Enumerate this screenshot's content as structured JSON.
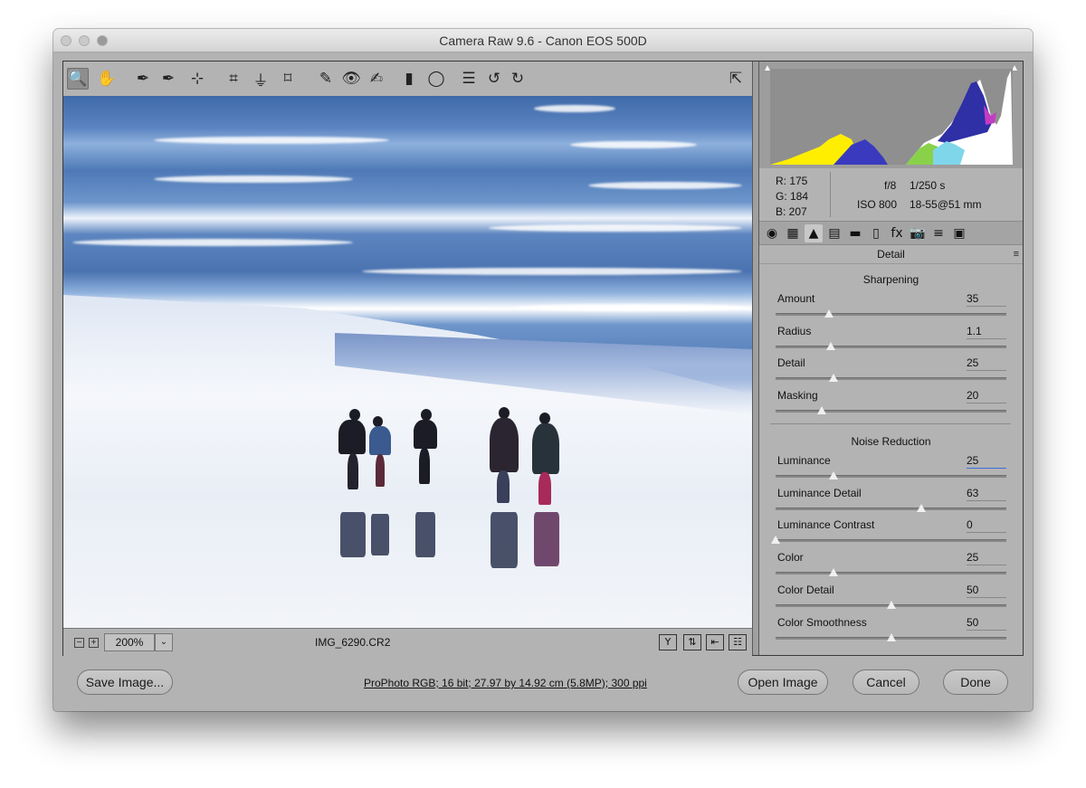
{
  "window": {
    "title": "Camera Raw 9.6  -  Canon EOS 500D"
  },
  "toolbar": {
    "tools": [
      {
        "name": "zoom-tool-icon",
        "glyph": "🔍"
      },
      {
        "name": "hand-tool-icon",
        "glyph": "✋"
      },
      {
        "name": "white-balance-tool-icon",
        "glyph": "✒"
      },
      {
        "name": "color-sampler-tool-icon",
        "glyph": "✒"
      },
      {
        "name": "targeted-adjustment-tool-icon",
        "glyph": "⊹"
      },
      {
        "name": "crop-tool-icon",
        "glyph": "⌗"
      },
      {
        "name": "straighten-tool-icon",
        "glyph": "⏚"
      },
      {
        "name": "transform-tool-icon",
        "glyph": "⌑"
      },
      {
        "name": "spot-removal-tool-icon",
        "glyph": "✎"
      },
      {
        "name": "red-eye-removal-tool-icon",
        "glyph": "👁"
      },
      {
        "name": "adjustment-brush-icon",
        "glyph": "✍"
      },
      {
        "name": "graduated-filter-icon",
        "glyph": "▮"
      },
      {
        "name": "radial-filter-icon",
        "glyph": "◯"
      },
      {
        "name": "preferences-icon",
        "glyph": "☰"
      },
      {
        "name": "rotate-ccw-icon",
        "glyph": "↺"
      },
      {
        "name": "rotate-cw-icon",
        "glyph": "↻"
      }
    ],
    "fullscreen_glyph": "⇱"
  },
  "image_footer": {
    "zoom_minus": "−",
    "zoom_plus": "+",
    "zoom_level": "200%",
    "zoom_dropdown": "⌄",
    "filename": "IMG_6290.CR2",
    "buttons": [
      {
        "name": "before-after-toggle-button",
        "glyph": "Y"
      },
      {
        "name": "swap-settings-button",
        "glyph": "⇅"
      },
      {
        "name": "copy-settings-button",
        "glyph": "⇤"
      },
      {
        "name": "preview-preferences-button",
        "glyph": "☷"
      }
    ]
  },
  "readout": {
    "r": "R:  175",
    "g": "G:  184",
    "b": "B:  207",
    "aperture": "f/8",
    "shutter": "1/250 s",
    "iso": "ISO 800",
    "lens": "18-55@51 mm"
  },
  "tabs": [
    {
      "name": "tab-basic-icon",
      "glyph": "◉"
    },
    {
      "name": "tab-tone-curve-icon",
      "glyph": "▦"
    },
    {
      "name": "tab-detail-icon",
      "glyph": "▲"
    },
    {
      "name": "tab-hsl-icon",
      "glyph": "▤"
    },
    {
      "name": "tab-split-toning-icon",
      "glyph": "▬"
    },
    {
      "name": "tab-lens-corrections-icon",
      "glyph": "▯"
    },
    {
      "name": "tab-effects-icon",
      "glyph": "fx"
    },
    {
      "name": "tab-camera-calibration-icon",
      "glyph": "📷"
    },
    {
      "name": "tab-presets-icon",
      "glyph": "≡"
    },
    {
      "name": "tab-snapshots-icon",
      "glyph": "▣"
    }
  ],
  "panel": {
    "title": "Detail",
    "menu_glyph": "≡",
    "sharpening_title": "Sharpening",
    "noise_title": "Noise Reduction",
    "sharpening": [
      {
        "label": "Amount",
        "value": "35",
        "level": 0.23
      },
      {
        "label": "Radius",
        "value": "1.1",
        "level": 0.24
      },
      {
        "label": "Detail",
        "value": "25",
        "level": 0.25
      },
      {
        "label": "Masking",
        "value": "20",
        "level": 0.2
      }
    ],
    "noise": [
      {
        "label": "Luminance",
        "value": "25",
        "level": 0.25
      },
      {
        "label": "Luminance Detail",
        "value": "63",
        "level": 0.63
      },
      {
        "label": "Luminance Contrast",
        "value": "0",
        "level": 0.0
      },
      {
        "label": "Color",
        "value": "25",
        "level": 0.25
      },
      {
        "label": "Color Detail",
        "value": "50",
        "level": 0.5
      },
      {
        "label": "Color Smoothness",
        "value": "50",
        "level": 0.5
      }
    ]
  },
  "bottom": {
    "save_label": "Save Image...",
    "workflow_text": "ProPhoto RGB; 16 bit; 27.97 by 14.92 cm (5.8MP); 300 ppi",
    "open_label": "Open Image",
    "cancel_label": "Cancel",
    "done_label": "Done"
  }
}
